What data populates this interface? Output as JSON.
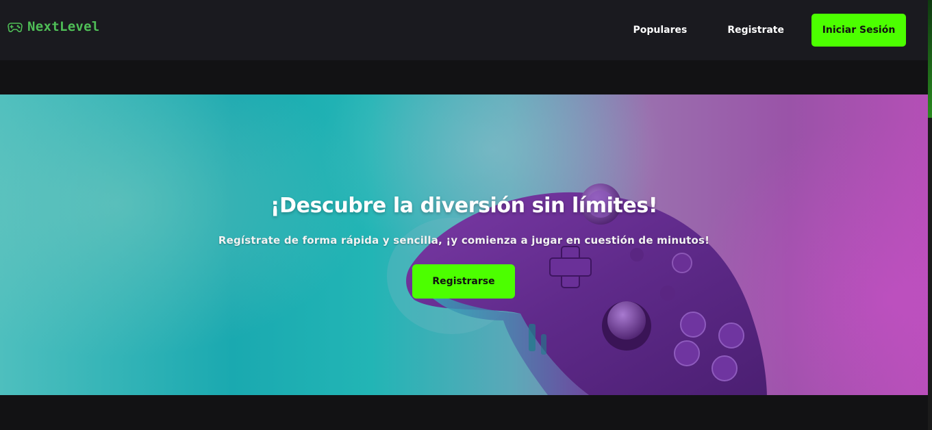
{
  "brand": {
    "name": "NextLevel",
    "icon": "gamepad-icon",
    "color": "#4fbf57"
  },
  "nav": {
    "populares": "Populares",
    "registrate": "Registrate",
    "login": "Iniciar Sesión"
  },
  "hero": {
    "title": "¡Descubre la diversión sin límites!",
    "subtitle": "Regístrate de forma rápida y sencilla, ¡y comienza a jugar en cuestión de minutos!",
    "cta": "Registrarse",
    "image": "purple-gamepad-controller"
  },
  "colors": {
    "accent": "#4cff00",
    "navbar": "#1a1a1f",
    "background": "#121214"
  }
}
